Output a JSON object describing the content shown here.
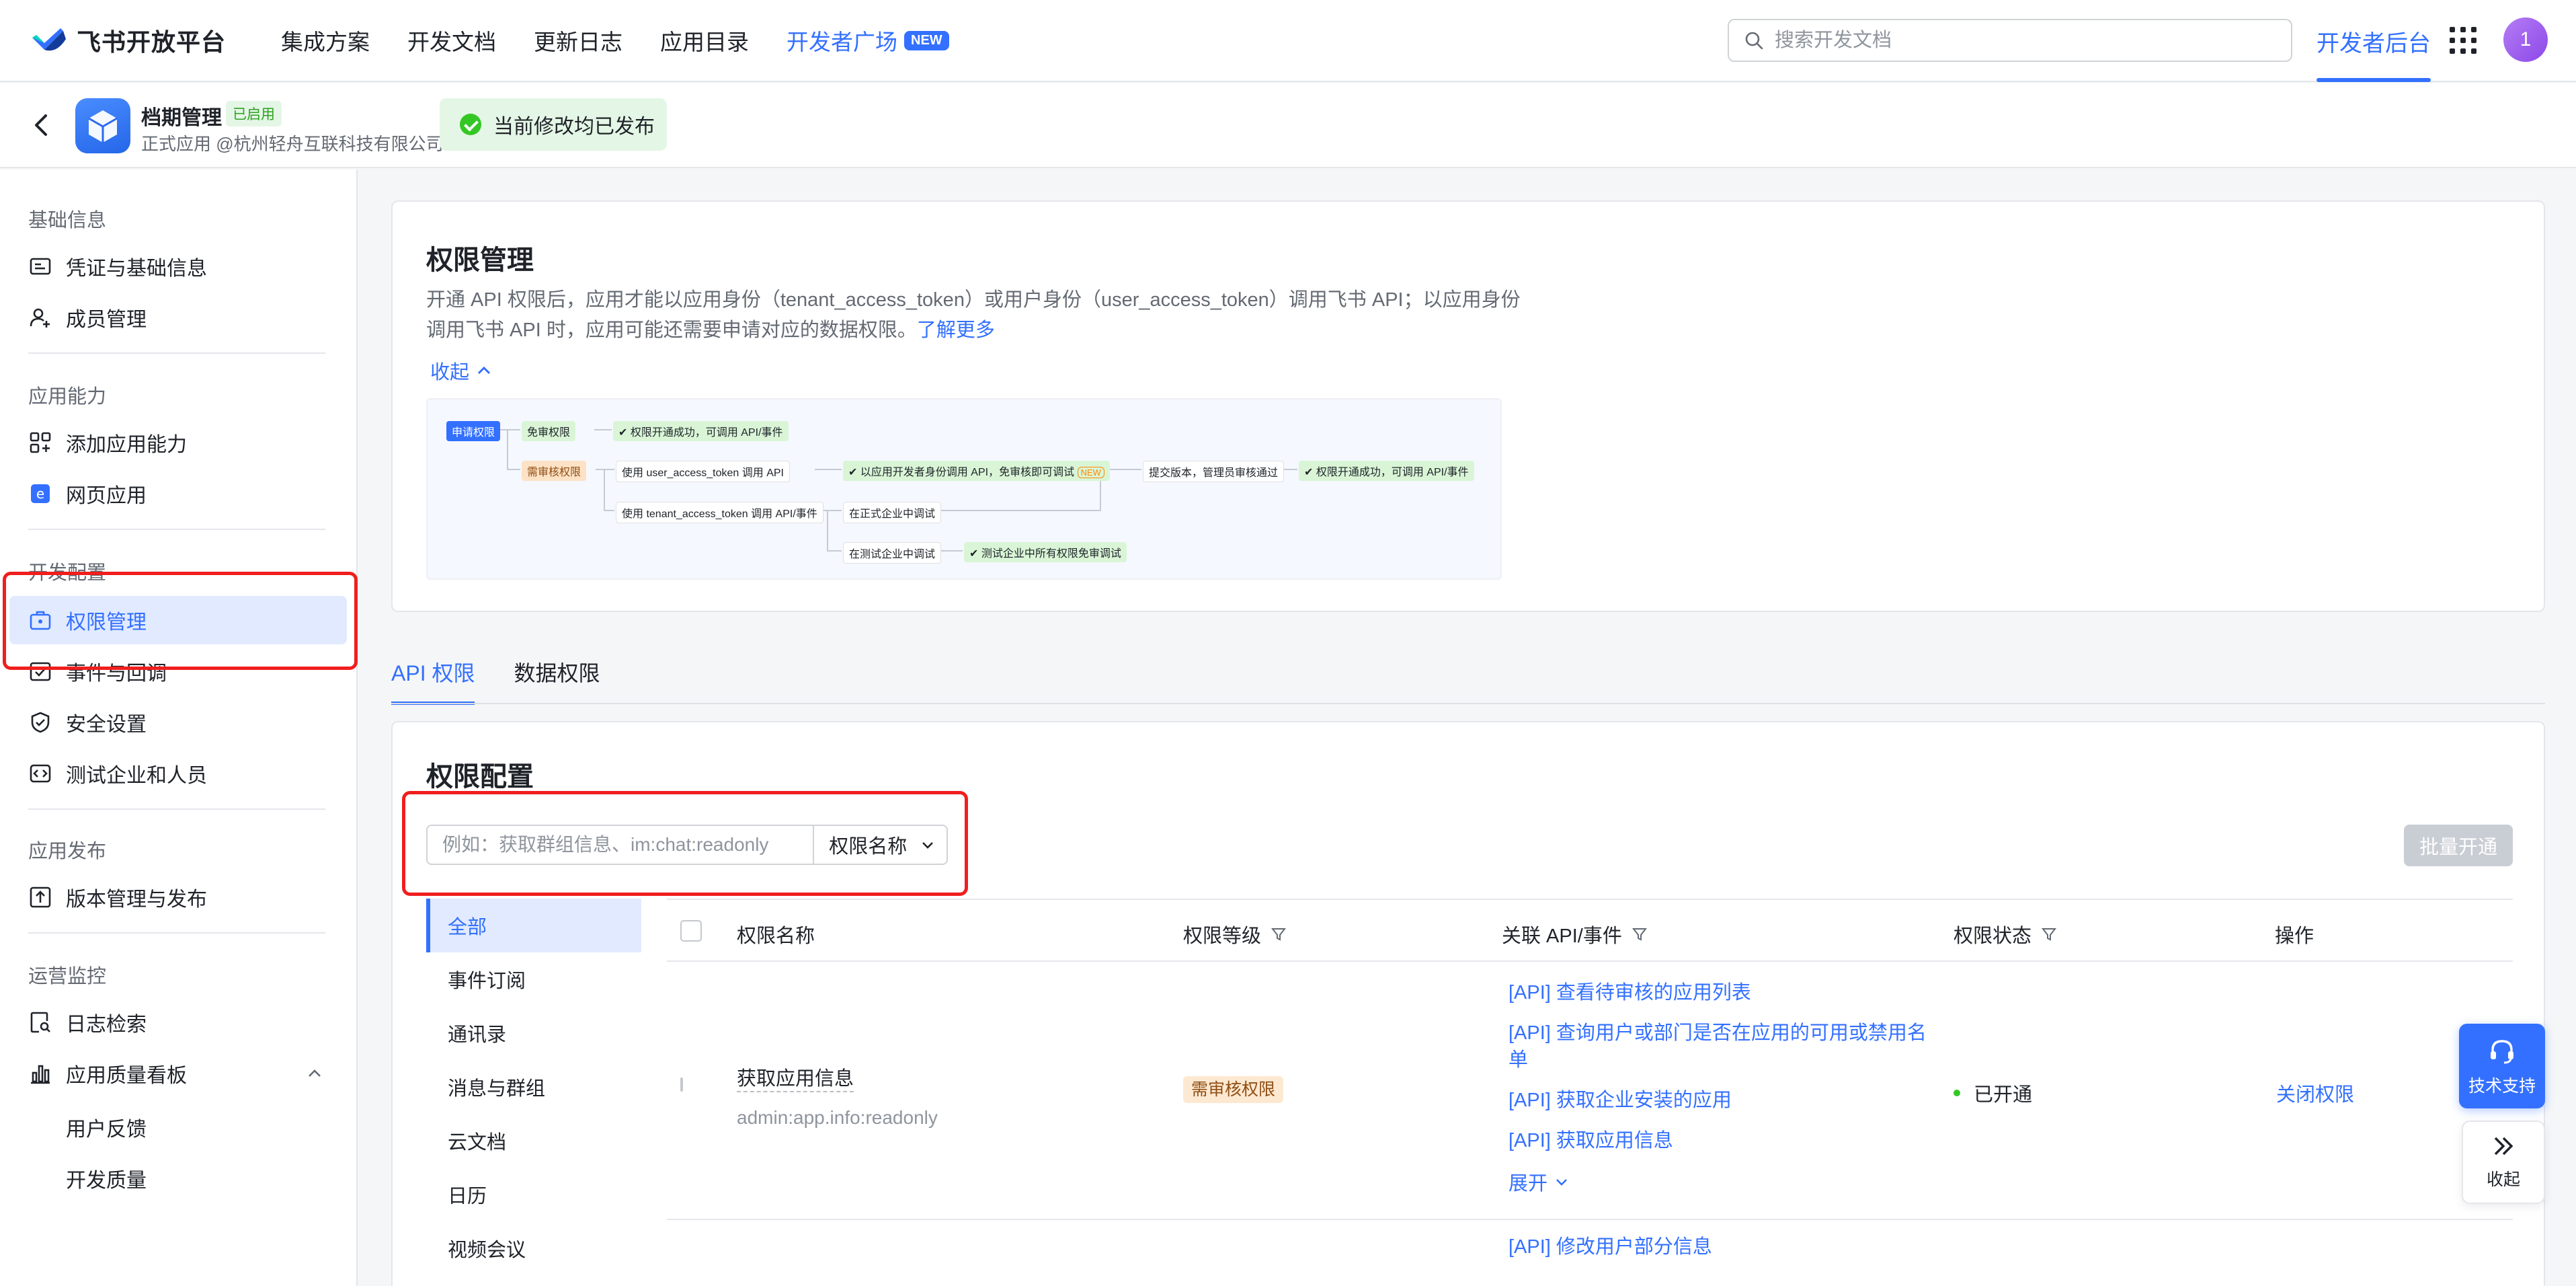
{
  "topnav": {
    "brand": "飞书开放平台",
    "links": [
      "集成方案",
      "开发文档",
      "更新日志",
      "应用目录"
    ],
    "developer_square": "开发者广场",
    "new_badge": "NEW",
    "search_placeholder": "搜索开发文档",
    "developer_console": "开发者后台",
    "avatar_text": "1"
  },
  "appbar": {
    "app_name": "档期管理",
    "enabled_badge": "已启用",
    "app_sub": "正式应用 @杭州轻舟互联科技有限公司",
    "publish_status": "当前修改均已发布"
  },
  "sidebar": {
    "sections": {
      "basic": "基础信息",
      "ability": "应用能力",
      "dev": "开发配置",
      "release": "应用发布",
      "ops": "运营监控"
    },
    "items": {
      "credentials": "凭证与基础信息",
      "members": "成员管理",
      "add_ability": "添加应用能力",
      "web_app": "网页应用",
      "permissions": "权限管理",
      "events": "事件与回调",
      "security": "安全设置",
      "test_org": "测试企业和人员",
      "versions": "版本管理与发布",
      "logs": "日志检索",
      "quality": "应用质量看板",
      "feedback": "用户反馈",
      "dev_quality": "开发质量"
    }
  },
  "intro": {
    "title": "权限管理",
    "desc_line1": "开通 API 权限后，应用才能以应用身份（tenant_access_token）或用户身份（user_access_token）调用飞书 API；以应用身份",
    "desc_line2": "调用飞书 API 时，应用可能还需要申请对应的数据权限。",
    "learn_more": "了解更多",
    "collapse": "收起",
    "flow": {
      "apply": "申请权限",
      "exempt": "免审权限",
      "success1": "权限开通成功，可调用 API/事件",
      "review": "需审核权限",
      "use_user_token": "使用 user_access_token 调用 API",
      "dev_identity": "以应用开发者身份调用 API，免审核即可调试",
      "new": "NEW",
      "submit": "提交版本，管理员审核通过",
      "success2": "权限开通成功，可调用 API/事件",
      "use_tenant_token": "使用 tenant_access_token 调用 API/事件",
      "prod_debug": "在正式企业中调试",
      "test_debug": "在测试企业中调试",
      "test_exempt": "测试企业中所有权限免审调试"
    }
  },
  "tabs": [
    "API 权限",
    "数据权限"
  ],
  "config": {
    "title": "权限配置",
    "search_placeholder": "例如：获取群组信息、im:chat:readonly",
    "select_value": "权限名称",
    "bulk_button": "批量开通",
    "categories": [
      "全部",
      "事件订阅",
      "通讯录",
      "消息与群组",
      "云文档",
      "日历",
      "视频会议"
    ],
    "columns": {
      "name": "权限名称",
      "level": "权限等级",
      "apis": "关联 API/事件",
      "status": "权限状态",
      "action": "操作"
    },
    "rows": [
      {
        "name": "获取应用信息",
        "key": "admin:app.info:readonly",
        "level": "需审核权限",
        "apis": [
          "[API] 查看待审核的应用列表",
          "[API] 查询用户或部门是否在应用的可用或禁用名单",
          "[API] 获取企业安装的应用",
          "[API] 获取应用信息"
        ],
        "expand": "展开",
        "status": "已开通",
        "action": "关闭权限"
      },
      {
        "apis": [
          "[API] 修改用户部分信息"
        ]
      }
    ]
  },
  "float": {
    "support": "技术支持",
    "collapse": "收起"
  },
  "colors": {
    "accent": "#3370ff",
    "success": "#34c724",
    "highlight_box": "#f01e1e"
  }
}
